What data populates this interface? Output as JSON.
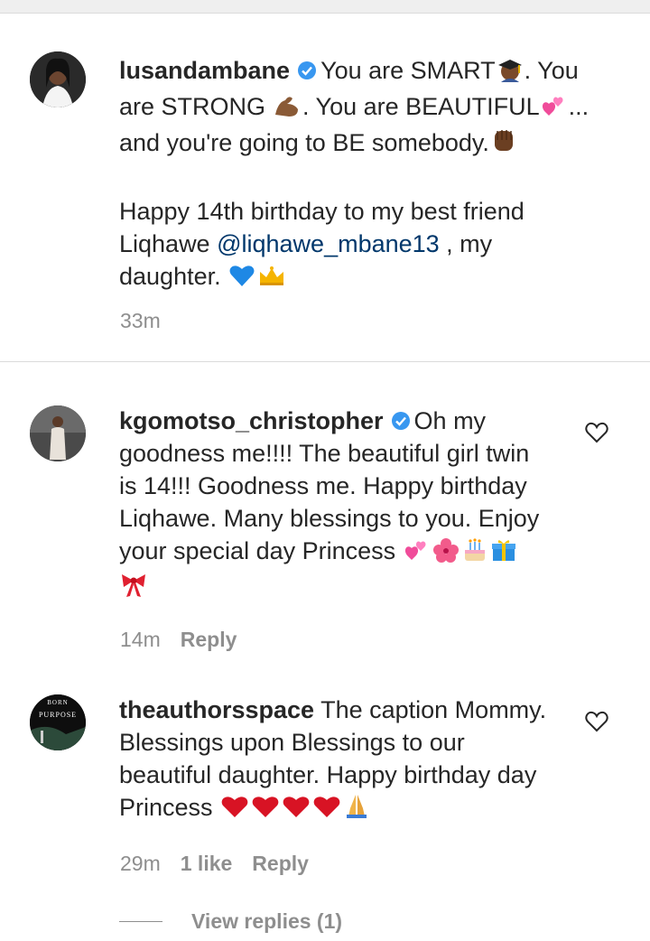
{
  "caption": {
    "username": "lusandambane",
    "line1a": "You are SMART",
    "line1b": ". You",
    "line2a": "are STRONG",
    "line2b": ". You are BEAUTIFUL",
    "line2c": "...",
    "line3": "and you're going to BE somebody.",
    "line4": "Happy 14th birthday to my best friend",
    "line5a": "Liqhawe ",
    "mention": "@liqhawe_mbane13",
    "line5b": " , my",
    "line6": "daughter. ",
    "time": "33m"
  },
  "comments": [
    {
      "username": "kgomotso_christopher",
      "line1": "Oh my",
      "line2": "goodness me!!!! The beautiful girl twin",
      "line3": "is 14!!! Goodness me. Happy birthday",
      "line4": "Liqhawe. Many blessings to you. Enjoy",
      "line5": "your special day Princess ",
      "time": "14m",
      "reply": "Reply"
    },
    {
      "username": "theauthorsspace",
      "line1": " The caption Mommy.",
      "line2": "Blessings upon Blessings to our",
      "line3": "beautiful daughter. Happy birthday day",
      "line4": "Princess ",
      "time": "29m",
      "likes": "1 like",
      "reply": "Reply",
      "avatar_text_1": "BORN",
      "avatar_text_2": "PURPOSE"
    }
  ],
  "view_replies": "View replies (1)"
}
